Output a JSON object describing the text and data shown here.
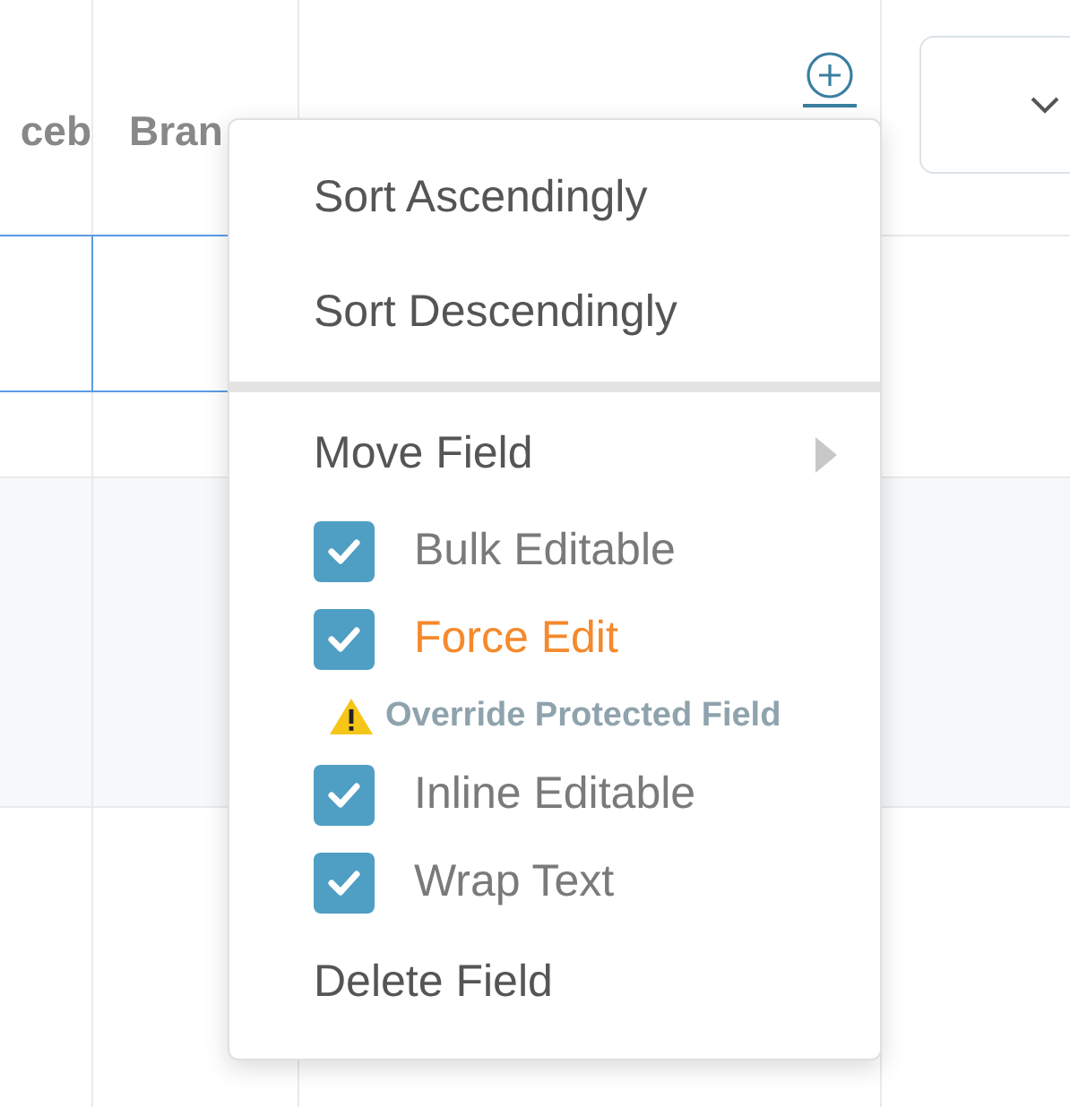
{
  "table": {
    "columns": [
      {
        "label": "ceb"
      },
      {
        "label": "Bran"
      }
    ]
  },
  "menu": {
    "items": [
      {
        "kind": "action",
        "label": "Sort Ascendingly"
      },
      {
        "kind": "action",
        "label": "Sort Descendingly"
      },
      {
        "kind": "divider"
      },
      {
        "kind": "submenu",
        "label": "Move Field"
      },
      {
        "kind": "checkbox",
        "label": "Bulk Editable",
        "checked": true
      },
      {
        "kind": "checkbox_warning",
        "label": "Force Edit",
        "checked": true
      },
      {
        "kind": "warning",
        "label": "Override Protected Field"
      },
      {
        "kind": "checkbox",
        "label": "Inline Editable",
        "checked": true
      },
      {
        "kind": "checkbox",
        "label": "Wrap Text",
        "checked": true
      },
      {
        "kind": "action",
        "label": "Delete Field"
      }
    ]
  }
}
